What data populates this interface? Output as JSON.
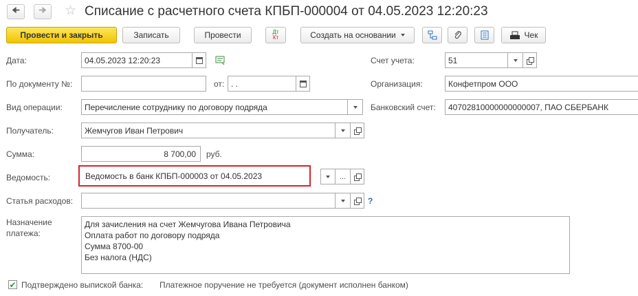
{
  "window": {
    "title": "Списание с расчетного счета КПБП-000004 от 04.05.2023 12:20:23",
    "back_icon": "arrow-left",
    "forward_icon": "arrow-right",
    "favorite_icon": "star"
  },
  "toolbar": {
    "post_close_label": "Провести и закрыть",
    "save_label": "Записать",
    "post_label": "Провести",
    "dtkt_label_top": "Дт",
    "dtkt_label_bottom": "Кт",
    "create_based_label": "Создать на основании",
    "check_label": "Чек"
  },
  "form": {
    "date": {
      "label": "Дата:",
      "value": "04.05.2023 12:20:23"
    },
    "doc_number": {
      "label": "По документу №:",
      "value": "",
      "from_label": "от:",
      "from_value": " .  ."
    },
    "operation_type": {
      "label": "Вид операции:",
      "value": "Перечисление сотруднику по договору подряда"
    },
    "recipient": {
      "label": "Получатель:",
      "value": "Жемчугов Иван Петрович"
    },
    "amount": {
      "label": "Сумма:",
      "value": "8 700,00",
      "currency": "руб."
    },
    "statement": {
      "label": "Ведомость:",
      "value": "Ведомость в банк КПБП-000003 от 04.05.2023",
      "select_label": "..."
    },
    "expense_item": {
      "label": "Статья расходов:",
      "value": "",
      "help": "?"
    },
    "purpose": {
      "label_line1": "Назначение",
      "label_line2": "платежа:",
      "lines": [
        "Для зачисления на счет Жемчугова Ивана Петровича",
        "Оплата работ по договору подряда",
        "Сумма 8700-00",
        "Без налога (НДС)"
      ]
    },
    "account": {
      "label": "Счет учета:",
      "value": "51"
    },
    "organization": {
      "label": "Организация:",
      "value": "Конфетпром ООО"
    },
    "bank_account": {
      "label": "Банковский счет:",
      "value": "40702810000000000007, ПАО СБЕРБАНК"
    },
    "confirmed": {
      "label": "Подтверждено выпиской банка:",
      "checked": true,
      "note": "Платежное поручение не требуется (документ исполнен банком)"
    }
  },
  "colors": {
    "primary_button": "#f2c400",
    "highlight_border": "#d8232a",
    "check_mark": "#2e9a2e",
    "help": "#2a6ebb"
  }
}
